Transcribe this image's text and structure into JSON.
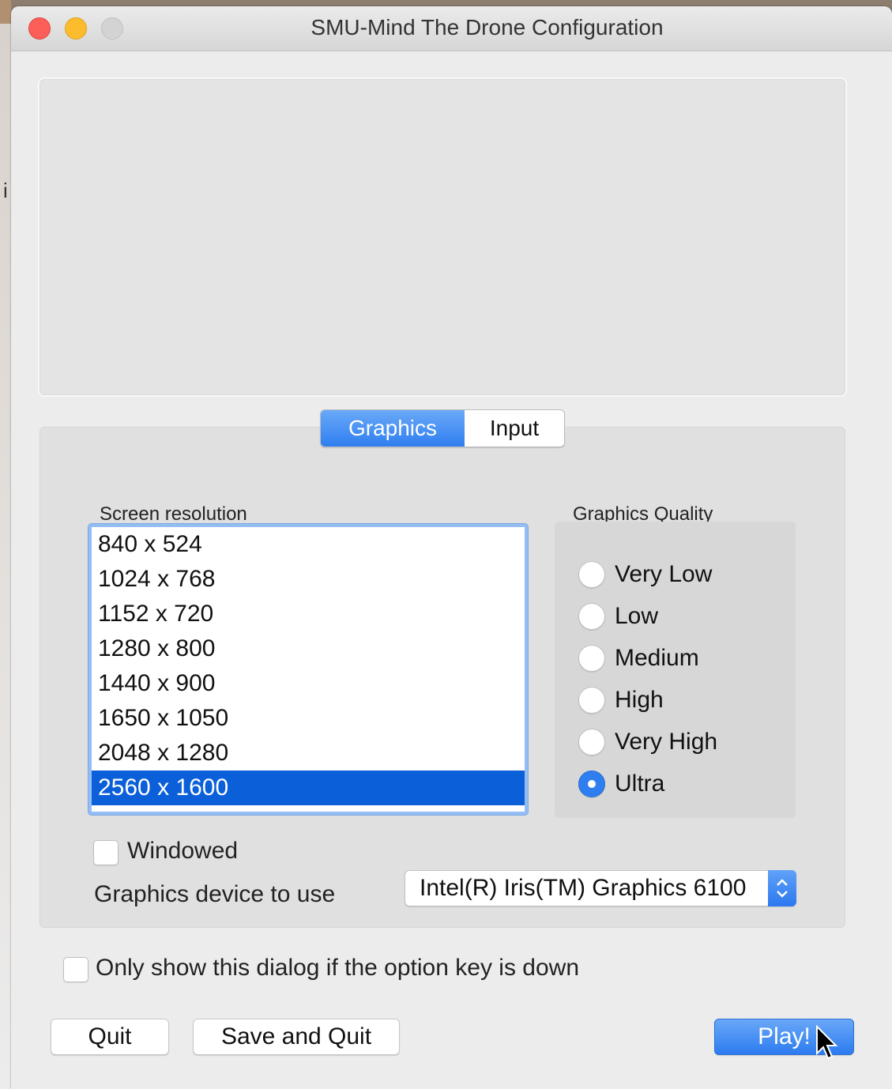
{
  "window": {
    "title": "SMU-Mind The Drone Configuration"
  },
  "background": {
    "edge_text": "i"
  },
  "tabs": [
    {
      "label": "Graphics",
      "active": true
    },
    {
      "label": "Input",
      "active": false
    }
  ],
  "graphics": {
    "resolution_label": "Screen resolution",
    "resolutions": [
      "840 x 524",
      "1024 x 768",
      "1152 x 720",
      "1280 x 800",
      "1440 x 900",
      "1650 x 1050",
      "2048 x 1280",
      "2560 x 1600"
    ],
    "selected_resolution": "2560 x 1600",
    "quality_label": "Graphics Quality",
    "quality_options": [
      "Very Low",
      "Low",
      "Medium",
      "High",
      "Very High",
      "Ultra"
    ],
    "selected_quality": "Ultra",
    "windowed_label": "Windowed",
    "windowed_checked": false,
    "device_label": "Graphics device to use",
    "device_value": "Intel(R) Iris(TM) Graphics 6100"
  },
  "option_key_label": "Only show this dialog if the option key is down",
  "option_key_checked": false,
  "buttons": {
    "quit": "Quit",
    "save_quit": "Save and Quit",
    "play": "Play!"
  },
  "colors": {
    "accent": "#2f7ef0",
    "selection": "#0b5fd8",
    "close": "#fc5f57",
    "minimize": "#fdbc2e"
  }
}
